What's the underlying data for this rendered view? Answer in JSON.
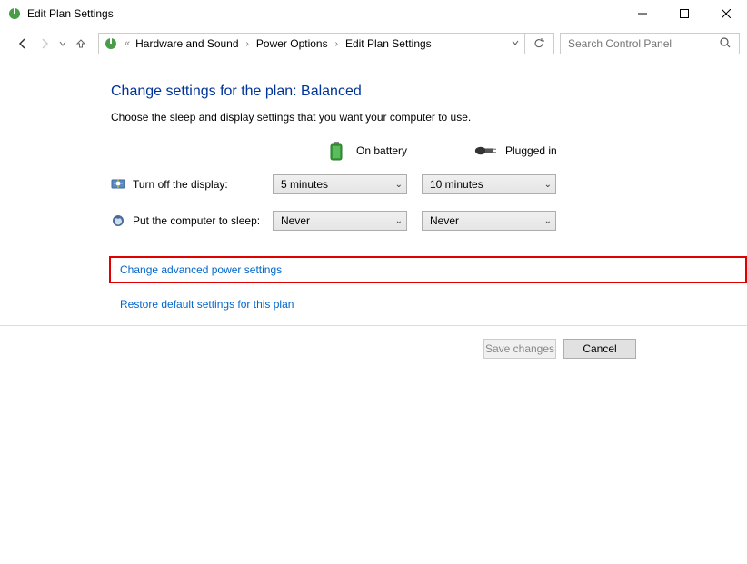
{
  "window": {
    "title": "Edit Plan Settings"
  },
  "breadcrumb": {
    "prefix": "«",
    "items": [
      "Hardware and Sound",
      "Power Options",
      "Edit Plan Settings"
    ]
  },
  "search": {
    "placeholder": "Search Control Panel"
  },
  "main": {
    "heading": "Change settings for the plan: Balanced",
    "subtext": "Choose the sleep and display settings that you want your computer to use.",
    "columns": {
      "battery": "On battery",
      "plugged": "Plugged in"
    },
    "rows": [
      {
        "label": "Turn off the display:",
        "battery_value": "5 minutes",
        "plugged_value": "10 minutes"
      },
      {
        "label": "Put the computer to sleep:",
        "battery_value": "Never",
        "plugged_value": "Never"
      }
    ],
    "links": {
      "advanced": "Change advanced power settings",
      "restore": "Restore default settings for this plan"
    }
  },
  "footer": {
    "save": "Save changes",
    "cancel": "Cancel"
  }
}
